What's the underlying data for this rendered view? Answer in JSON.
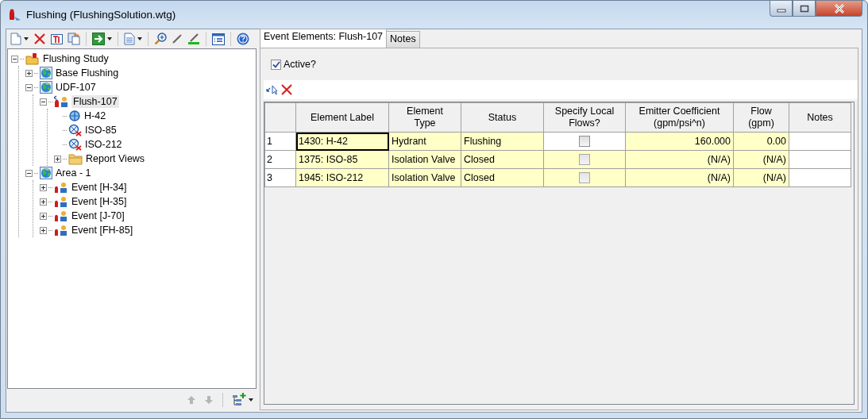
{
  "window": {
    "title": "Flushing (FlushingSolution.wtg)"
  },
  "tree": [
    {
      "label": "Flushing Study",
      "kind": "study",
      "expanded": true,
      "selected": false,
      "children": [
        {
          "label": "Base Flushing",
          "kind": "scenario",
          "expanded": false,
          "selected": false
        },
        {
          "label": "UDF-107",
          "kind": "scenario",
          "expanded": true,
          "selected": false,
          "children": [
            {
              "label": "Flush-107",
              "kind": "flushing",
              "expanded": true,
              "selected": true,
              "children": [
                {
                  "label": "H-42",
                  "kind": "hydrant",
                  "selected": false
                },
                {
                  "label": "ISO-85",
                  "kind": "valve",
                  "selected": false
                },
                {
                  "label": "ISO-212",
                  "kind": "valve",
                  "selected": false
                },
                {
                  "label": "Report Views",
                  "kind": "folder",
                  "expanded": false,
                  "selected": false
                }
              ]
            }
          ]
        },
        {
          "label": "Area  - 1",
          "kind": "scenario",
          "expanded": true,
          "selected": false,
          "children": [
            {
              "label": "Event [H-34]",
              "kind": "event",
              "expanded": false,
              "selected": false
            },
            {
              "label": "Event [H-35]",
              "kind": "event",
              "expanded": false,
              "selected": false
            },
            {
              "label": "Event [J-70]",
              "kind": "event",
              "expanded": false,
              "selected": false
            },
            {
              "label": "Event [FH-85]",
              "kind": "event",
              "expanded": false,
              "selected": false
            }
          ]
        }
      ]
    }
  ],
  "tabs": [
    {
      "label": "Event Elements:  Flush-107",
      "selected": true
    },
    {
      "label": "Notes",
      "selected": false
    }
  ],
  "active": {
    "label": "Active?",
    "checked": true
  },
  "table": {
    "columns": [
      "",
      "Element Label",
      "Element\nType",
      "Status",
      "Specify Local\nFlows?",
      "Emitter Coefficient\n(gpm/psi^n)",
      "Flow\n(gpm)",
      "Notes"
    ],
    "rows": [
      {
        "number": "1",
        "label": "1430: H-42",
        "type": "Hydrant",
        "status": "Flushing",
        "specify_local_flows": {
          "checked": false,
          "disabled": false
        },
        "emitter_coefficient": "160.000",
        "flow": "0.00",
        "focused": true
      },
      {
        "number": "2",
        "label": "1375: ISO-85",
        "type": "Isolation Valve",
        "status": "Closed",
        "specify_local_flows": {
          "checked": false,
          "disabled": true
        },
        "emitter_coefficient": "(N/A)",
        "flow": "(N/A)",
        "focused": false
      },
      {
        "number": "3",
        "label": "1945: ISO-212",
        "type": "Isolation Valve",
        "status": "Closed",
        "specify_local_flows": {
          "checked": false,
          "disabled": true
        },
        "emitter_coefficient": "(N/A)",
        "flow": "(N/A)",
        "focused": false
      }
    ]
  }
}
